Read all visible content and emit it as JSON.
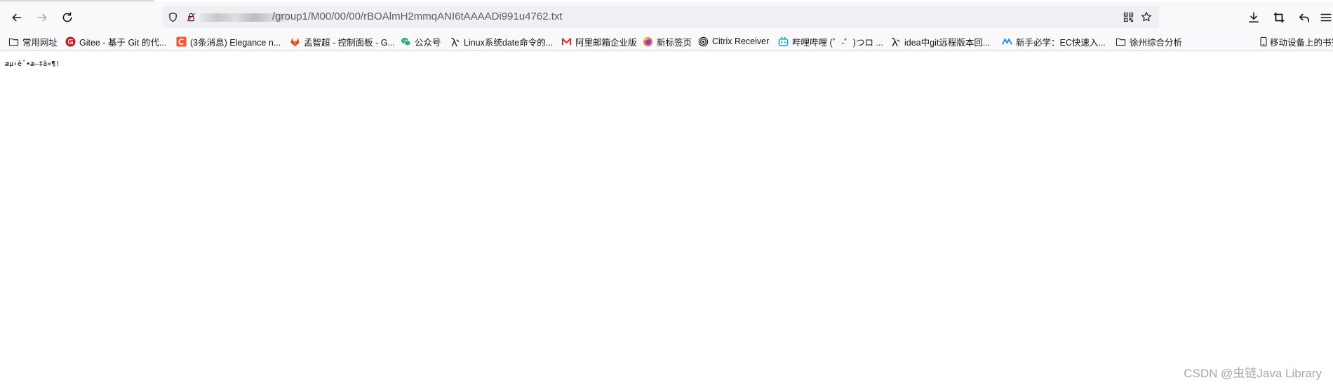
{
  "toolbar": {
    "url_path": "/group1/M00/00/00/rBOAlmH2mmqANI6tAAAADi991u4762.txt",
    "icons": [
      "back-icon",
      "forward-icon",
      "reload-icon",
      "shield-icon",
      "permissions-icon",
      "qr-code-icon",
      "star-icon",
      "download-icon",
      "screenshot-icon",
      "undo-icon",
      "menu-icon"
    ]
  },
  "bookmarks": [
    {
      "label": "常用网址",
      "icon": "folder-icon"
    },
    {
      "label": "Gitee - 基于 Git 的代...",
      "icon": "gitee-icon",
      "color": "#c71d23"
    },
    {
      "label": "(3条消息) Elegance n...",
      "icon": "csdn-icon",
      "color": "#fc5531"
    },
    {
      "label": "孟智超 - 控制面板 - G...",
      "icon": "gitlab-icon",
      "color": "#e24329"
    },
    {
      "label": "公众号",
      "icon": "wechat-icon",
      "color": "#2aae67"
    },
    {
      "label": "Linux系统date命令的...",
      "icon": "lambda-icon"
    },
    {
      "label": "阿里邮箱企业版",
      "icon": "mail-icon",
      "color": "#d93025"
    },
    {
      "label": "新标签页",
      "icon": "firefox-icon",
      "color": "#ff7139"
    },
    {
      "label": "Citrix Receiver",
      "icon": "citrix-icon"
    },
    {
      "label": "哔哩哔哩 (゜-゜)つロ ...",
      "icon": "bilibili-icon",
      "color": "#00a1d6"
    },
    {
      "label": "idea中git远程版本回...",
      "icon": "lambda-icon"
    },
    {
      "label": "新手必学：EC快速入...",
      "icon": "ec-icon",
      "color": "#1a8cff"
    },
    {
      "label": "徐州综合分析",
      "icon": "folder-icon"
    },
    {
      "label": "移动设备上的书签",
      "icon": "mobile-icon"
    }
  ],
  "content": {
    "text": "æµ‹è¯•æ–‡ä»¶!"
  },
  "watermark": "CSDN @虫链Java Library"
}
